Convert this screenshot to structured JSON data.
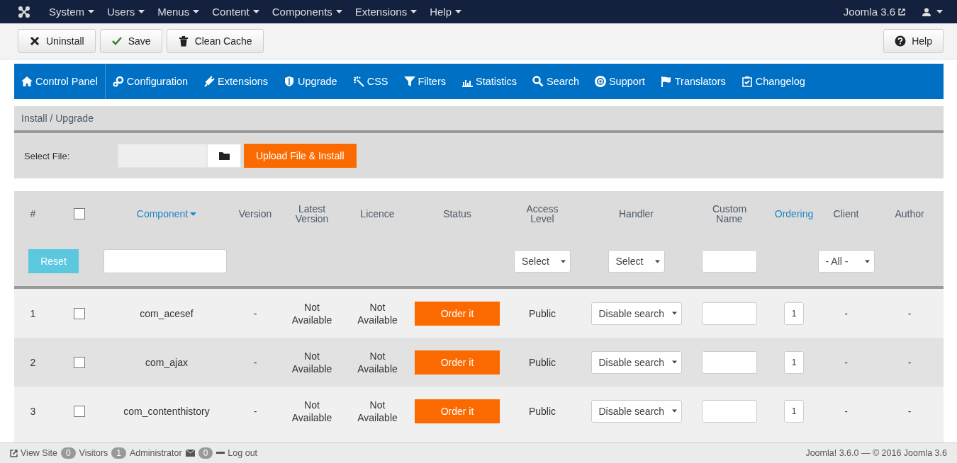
{
  "topnav": {
    "menus": [
      "System",
      "Users",
      "Menus",
      "Content",
      "Components",
      "Extensions",
      "Help"
    ],
    "site_link": "Joomla 3.6"
  },
  "toolbar": {
    "buttons": [
      "Uninstall",
      "Save",
      "Clean Cache"
    ],
    "help": "Help"
  },
  "submenu": {
    "items": [
      "Control Panel",
      "Configuration",
      "Extensions",
      "Upgrade",
      "CSS",
      "Filters",
      "Statistics",
      "Search",
      "Support",
      "Translators",
      "Changelog"
    ]
  },
  "install": {
    "title": "Install / Upgrade",
    "label": "Select File:",
    "button": "Upload File & Install"
  },
  "table": {
    "select_all": {
      "checked": false
    },
    "columns": [
      {
        "label": "#",
        "sortable": false,
        "sorted": false
      },
      {
        "label": "Component",
        "sortable": true,
        "sorted": true
      },
      {
        "label": "Version",
        "sortable": false,
        "sorted": false
      },
      {
        "label": "Latest Version",
        "sortable": false,
        "sorted": false
      },
      {
        "label": "Licence",
        "sortable": false,
        "sorted": false
      },
      {
        "label": "Status",
        "sortable": false,
        "sorted": false
      },
      {
        "label": "Access Level",
        "sortable": false,
        "sorted": false
      },
      {
        "label": "Handler",
        "sortable": false,
        "sorted": false
      },
      {
        "label": "Custom Name",
        "sortable": false,
        "sorted": false
      },
      {
        "label": "Ordering",
        "sortable": true,
        "sorted": false
      },
      {
        "label": "Client",
        "sortable": false,
        "sorted": false
      },
      {
        "label": "Author",
        "sortable": false,
        "sorted": false
      }
    ],
    "filters": {
      "reset": "Reset",
      "access": "Select",
      "handler": "Select",
      "client": "- All -"
    },
    "rows": [
      {
        "number": "1",
        "checked": false,
        "component": "com_acesef",
        "version": "-",
        "latest": "Not Available",
        "licence": "Not Available",
        "status": "Order it",
        "access": "Public",
        "handler": "Disable search",
        "ordering": "1",
        "client": "-",
        "author": "-"
      },
      {
        "number": "2",
        "checked": false,
        "component": "com_ajax",
        "version": "-",
        "latest": "Not Available",
        "licence": "Not Available",
        "status": "Order it",
        "access": "Public",
        "handler": "Disable search",
        "ordering": "1",
        "client": "-",
        "author": "-"
      },
      {
        "number": "3",
        "checked": false,
        "component": "com_contenthistory",
        "version": "-",
        "latest": "Not Available",
        "licence": "Not Available",
        "status": "Order it",
        "access": "Public",
        "handler": "Disable search",
        "ordering": "1",
        "client": "-",
        "author": "-"
      }
    ]
  },
  "status_bar": {
    "view_site": "View Site",
    "visitors_count": "0",
    "visitors": "Visitors",
    "admins_count": "1",
    "admins": "Administrator",
    "messages_count": "0",
    "logout": "Log out",
    "copyright": "Joomla! 3.6.0 — © 2016 Joomla 3.6"
  }
}
